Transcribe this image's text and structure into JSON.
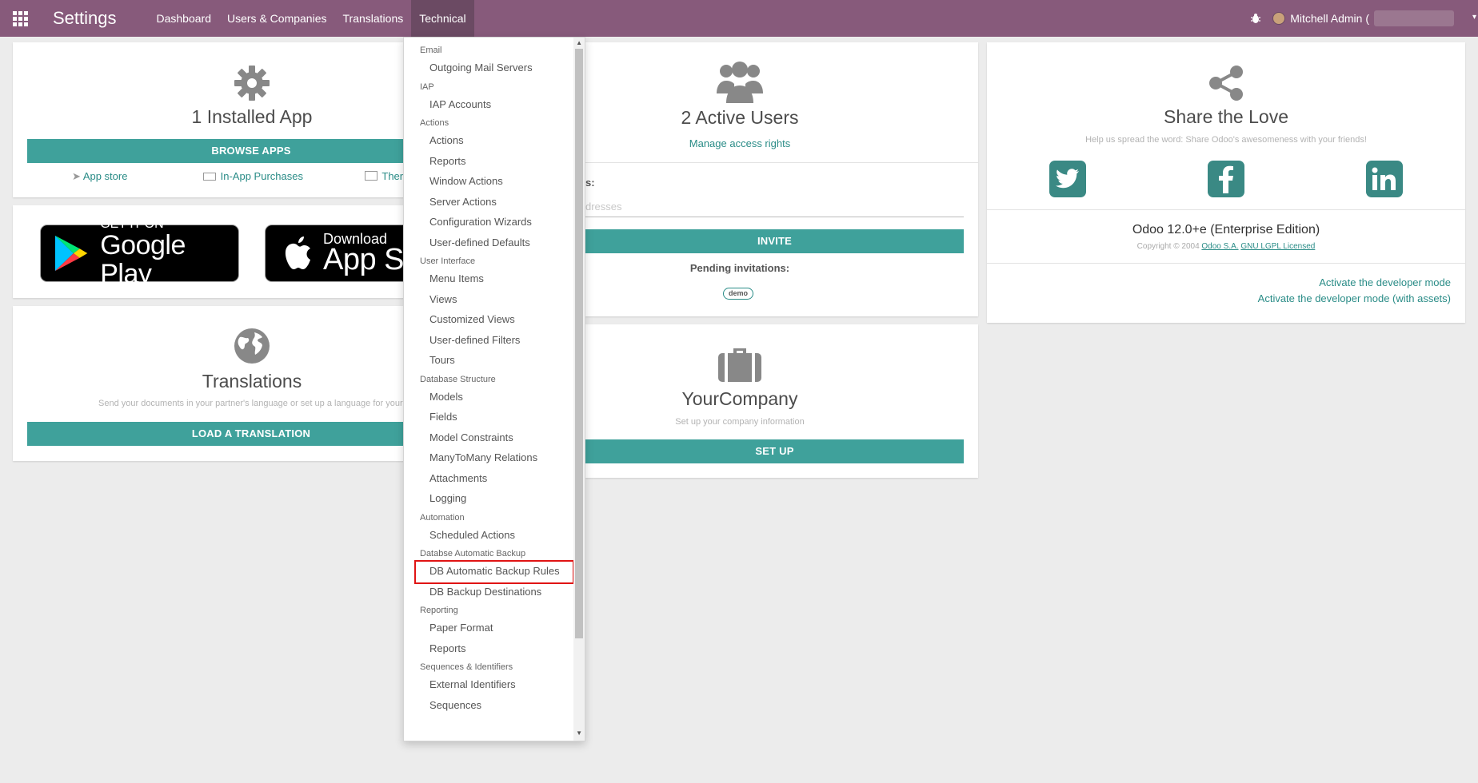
{
  "app": {
    "title": "Settings"
  },
  "navbar": {
    "menu": [
      "Dashboard",
      "Users & Companies",
      "Translations",
      "Technical"
    ],
    "active_menu": "Technical",
    "user": "Mitchell Admin ("
  },
  "apps_card": {
    "title": "1 Installed App",
    "button": "BROWSE APPS",
    "links": [
      "App store",
      "In-App Purchases",
      "Ther"
    ]
  },
  "stores": {
    "google_small": "GET IT ON",
    "google_large": "Google Play",
    "apple_small": "Download",
    "apple_large": "App St"
  },
  "translations_card": {
    "title": "Translations",
    "subtitle": "Send your documents in your partner's language or set up a language for your user",
    "button": "LOAD A TRANSLATION"
  },
  "users_card": {
    "title": "2 Active Users",
    "link": "Manage access rights",
    "invite_label": "s:",
    "email_placeholder": "dresses",
    "invite_button": "INVITE",
    "pending_label": "Pending invitations:",
    "pending_tag": "demo"
  },
  "company_card": {
    "title": "YourCompany",
    "subtitle": "Set up your company information",
    "button": "SET UP"
  },
  "share_card": {
    "title": "Share the Love",
    "subtitle": "Help us spread the word: Share Odoo's awesomeness with your friends!",
    "edition": "Odoo 12.0+e (Enterprise Edition)",
    "copyright": "Copyright © 2004",
    "company_link": "Odoo S.A.",
    "license_link": "GNU LGPL Licensed",
    "dev_mode": "Activate the developer mode",
    "dev_mode_assets": "Activate the developer mode (with assets)"
  },
  "technical_menu": {
    "sections": [
      {
        "header": "Email",
        "items": [
          "Outgoing Mail Servers"
        ]
      },
      {
        "header": "IAP",
        "items": [
          "IAP Accounts"
        ]
      },
      {
        "header": "Actions",
        "items": [
          "Actions",
          "Reports",
          "Window Actions",
          "Server Actions",
          "Configuration Wizards",
          "User-defined Defaults"
        ]
      },
      {
        "header": "User Interface",
        "items": [
          "Menu Items",
          "Views",
          "Customized Views",
          "User-defined Filters",
          "Tours"
        ]
      },
      {
        "header": "Database Structure",
        "items": [
          "Models",
          "Fields",
          "Model Constraints",
          "ManyToMany Relations",
          "Attachments",
          "Logging"
        ]
      },
      {
        "header": "Automation",
        "items": [
          "Scheduled Actions"
        ]
      },
      {
        "header": "Databse Automatic Backup",
        "items": [
          "DB Automatic Backup Rules",
          "DB Backup Destinations"
        ]
      },
      {
        "header": "Reporting",
        "items": [
          "Paper Format",
          "Reports"
        ]
      },
      {
        "header": "Sequences & Identifiers",
        "items": [
          "External Identifiers",
          "Sequences"
        ]
      }
    ],
    "highlighted_item": "DB Automatic Backup Rules"
  },
  "colors": {
    "navbar": "#875a7b",
    "accent": "#3fa19b",
    "link": "#2a8c87",
    "highlight_border": "#e01414"
  }
}
